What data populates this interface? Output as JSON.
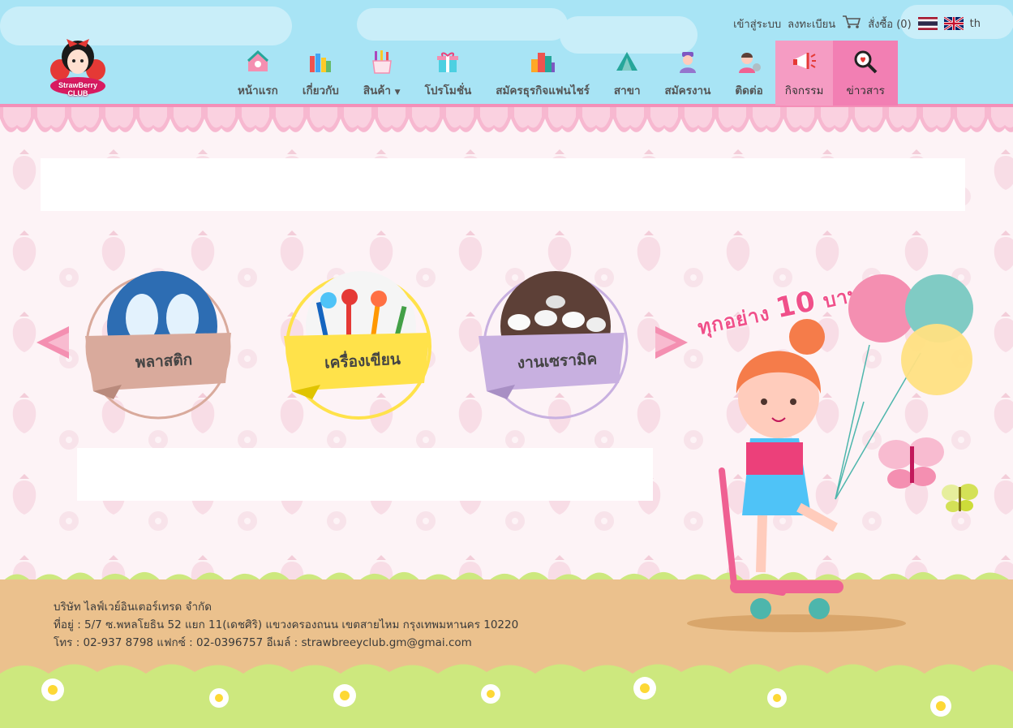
{
  "brand": {
    "logo_line1": "StrawBerry",
    "logo_line2": "CLUB"
  },
  "topbar": {
    "login": "เข้าสู่ระบบ",
    "register": "ลงทะเบียน",
    "cart": "สั่งซื้อ (0)",
    "lang": "th"
  },
  "nav": {
    "home": "หน้าแรก",
    "about": "เกี่ยวกับ",
    "products": "สินค้า",
    "promotion": "โปรโมชั่น",
    "franchise": "สมัครธุรกิจแฟนไชร์",
    "branches": "สาขา",
    "jobs": "สมัครงาน",
    "contact": "ติดต่อ",
    "activities": "กิจกรรม",
    "news": "ข่าวสาร"
  },
  "categories": [
    {
      "label": "พลาสติก",
      "color": "#d9aa9c"
    },
    {
      "label": "เครื่องเขียน",
      "color": "#ffe24a"
    },
    {
      "label": "งานเซรามิค",
      "color": "#c8b0e0"
    }
  ],
  "promo": {
    "text": "ทุกอย่าง",
    "price": "10",
    "unit": "บาท"
  },
  "footer": {
    "company": "บริษัท ไลฟ์เวย์อินเตอร์เทรด จำกัด",
    "address": "ที่อยู่ : 5/7 ซ.พหลโยธิน 52 แยก 11(เดชศิริ) แขวงครองถนน เขตสายไหม กรุงเทพมหานคร 10220",
    "contact": "โทร : 02-937 8798 แฟกซ์ : 02-0396757 อีเมล์ : strawbreeyclub.gm@gmai.com"
  },
  "colors": {
    "header_bg": "#a8e4f5",
    "accent_pink": "#f27fb3",
    "ground": "#ebc18d",
    "grass": "#cde87e"
  }
}
